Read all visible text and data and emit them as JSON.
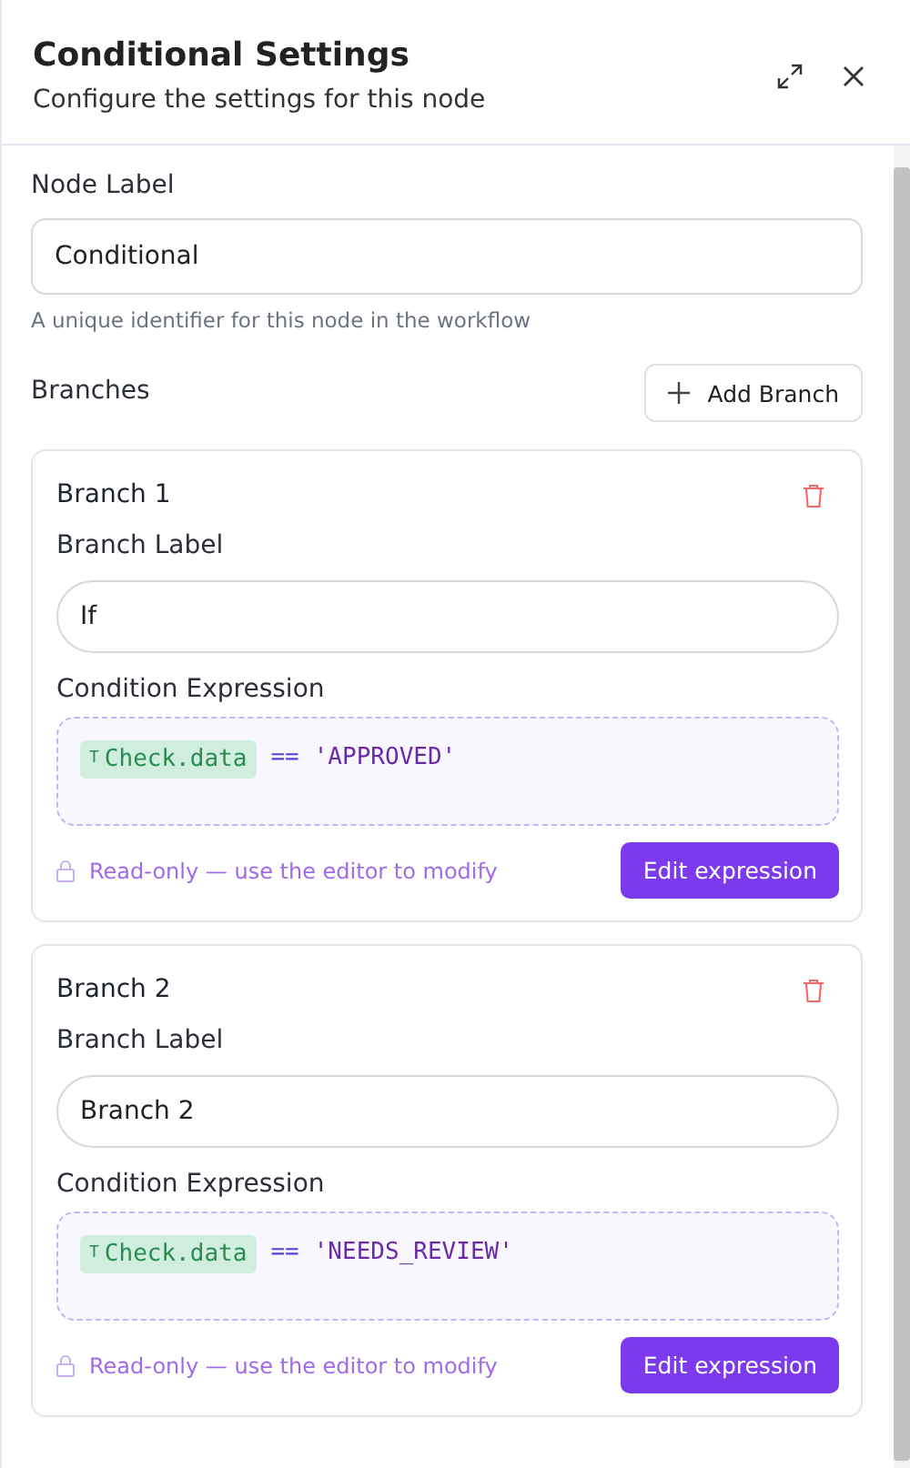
{
  "header": {
    "title": "Conditional Settings",
    "subtitle": "Configure the settings for this node"
  },
  "node_label": {
    "label": "Node Label",
    "value": "Conditional",
    "help": "A unique identifier for this node in the workflow"
  },
  "branches": {
    "title": "Branches",
    "add_button": "Add Branch",
    "items": [
      {
        "name": "Branch 1",
        "label_caption": "Branch Label",
        "label_value": "If",
        "expression_caption": "Condition Expression",
        "variable_type": "T",
        "variable": "Check.data",
        "operator": "==",
        "literal": "'APPROVED'",
        "readonly_note": "Read-only — use the editor to modify",
        "edit_button": "Edit expression"
      },
      {
        "name": "Branch 2",
        "label_caption": "Branch Label",
        "label_value": "Branch 2",
        "expression_caption": "Condition Expression",
        "variable_type": "T",
        "variable": "Check.data",
        "operator": "==",
        "literal": "'NEEDS_REVIEW'",
        "readonly_note": "Read-only — use the editor to modify",
        "edit_button": "Edit expression"
      }
    ]
  }
}
